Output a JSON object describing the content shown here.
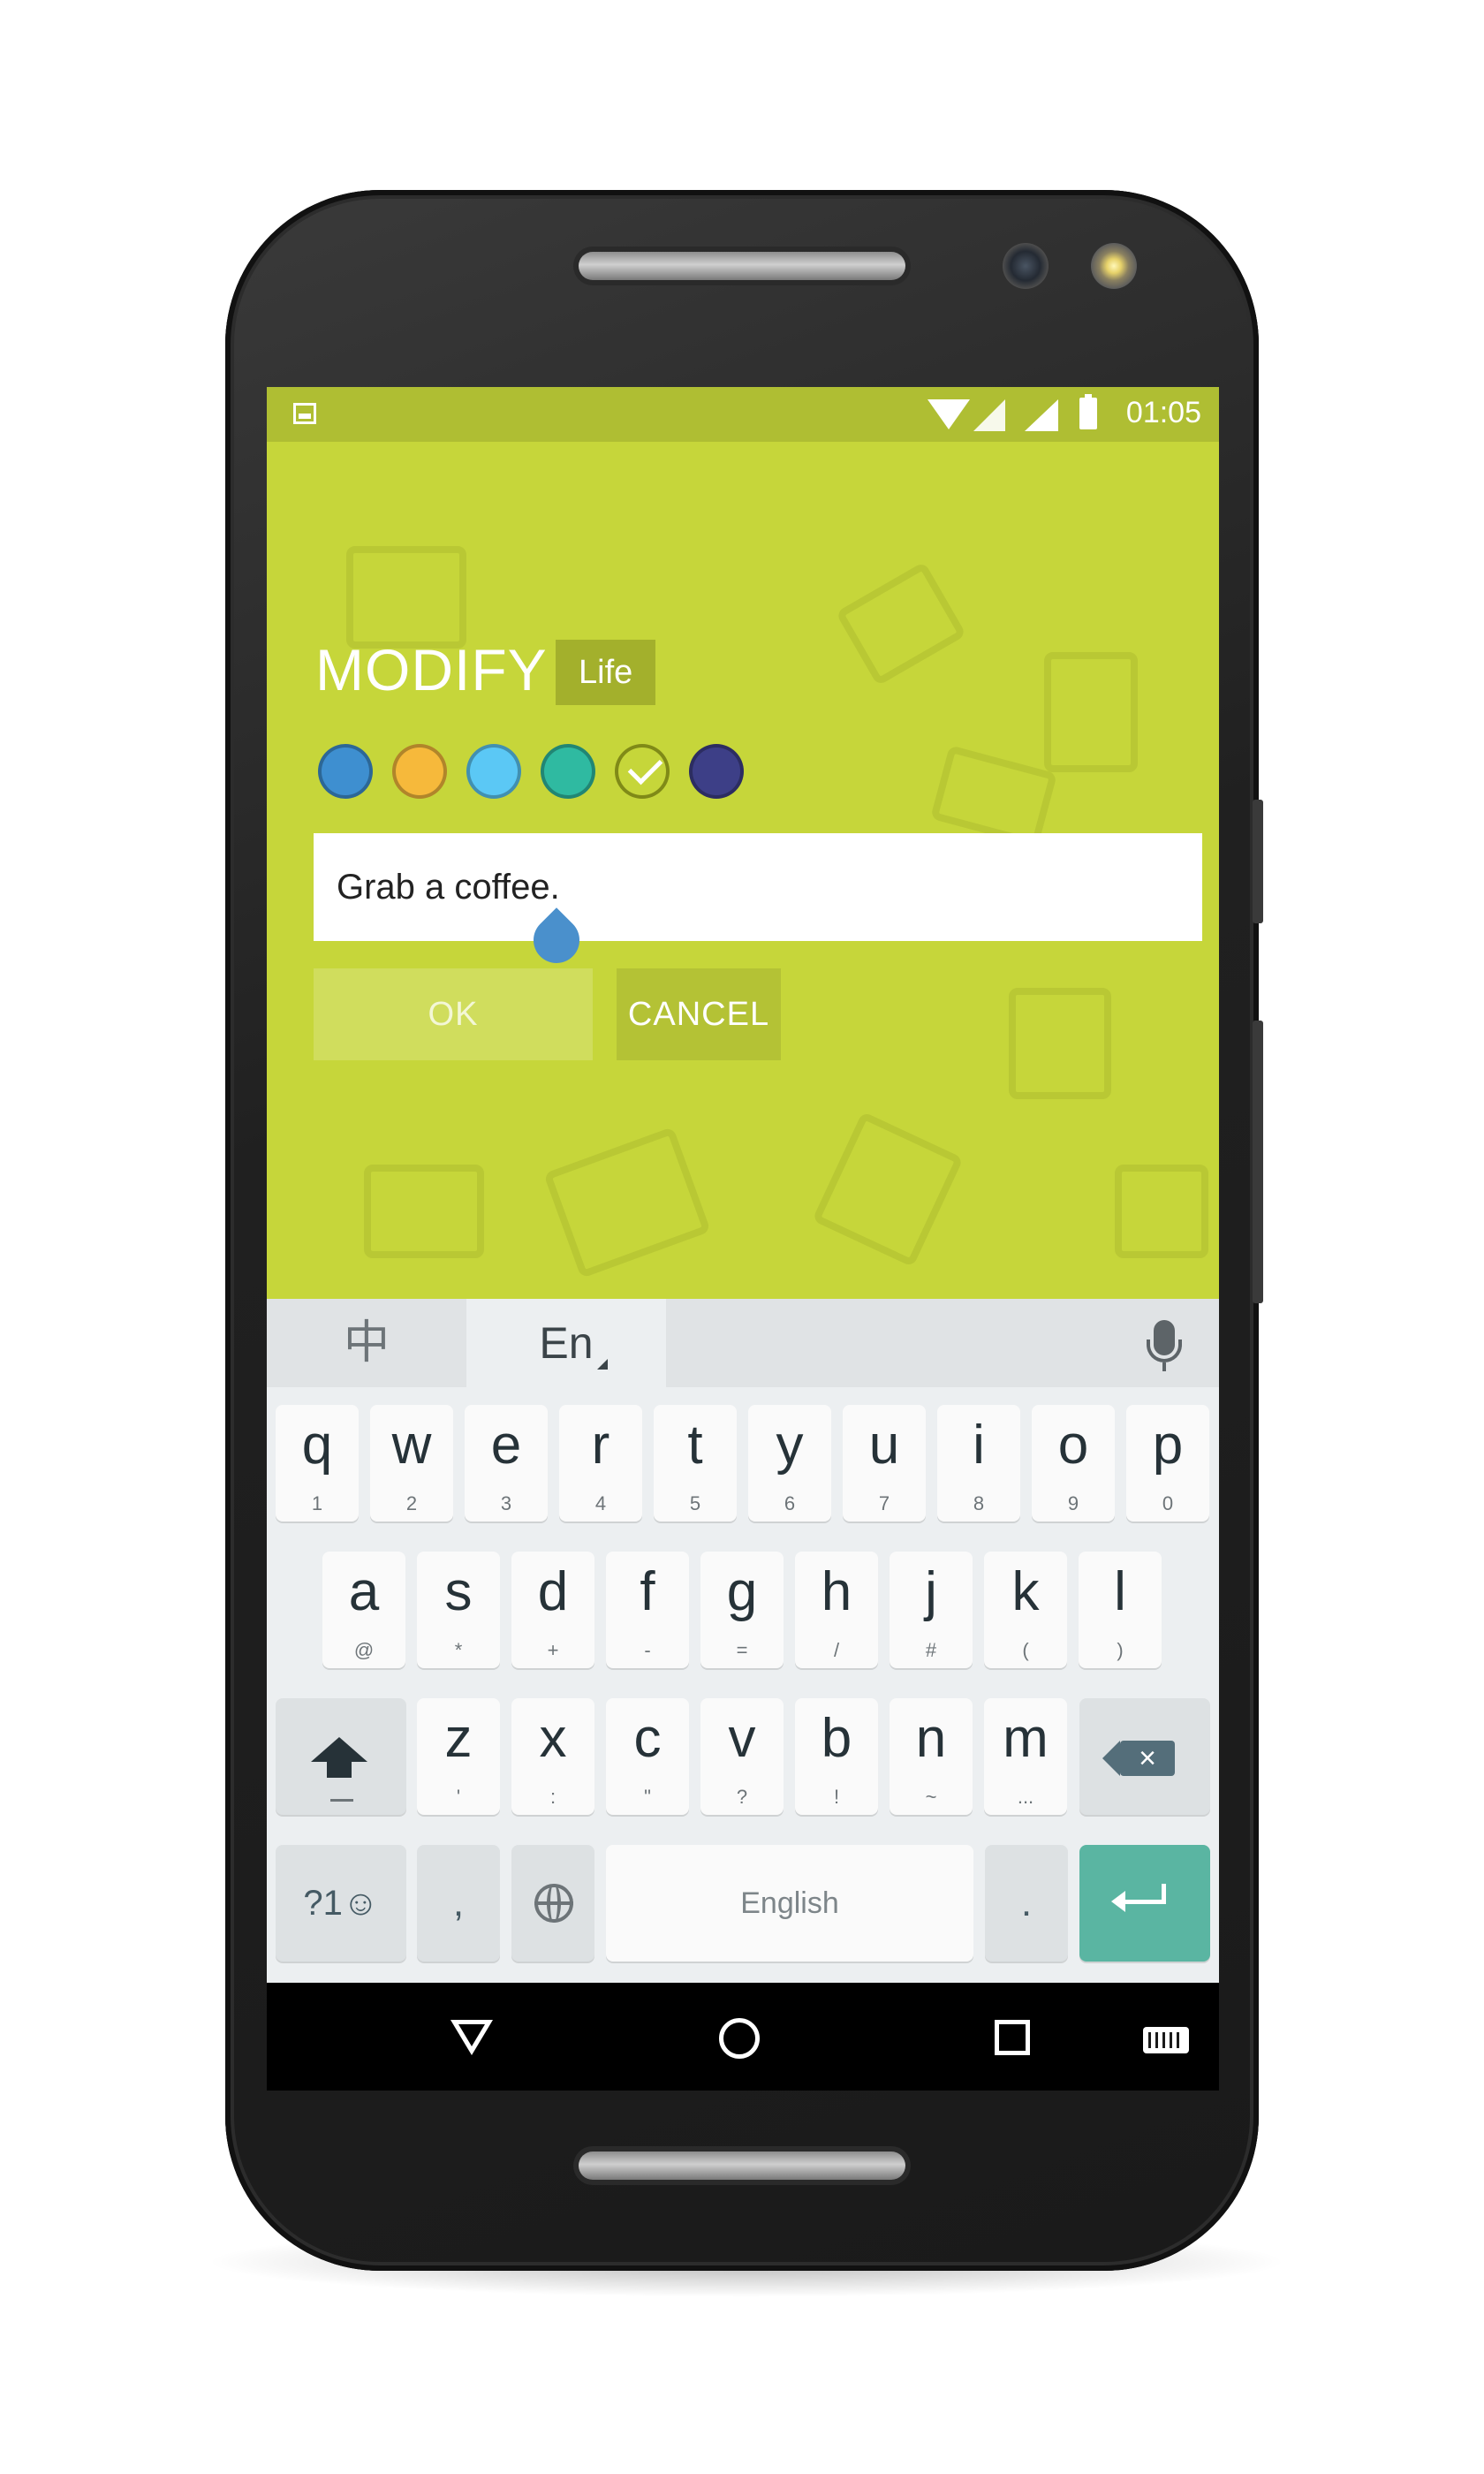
{
  "status_bar": {
    "time": "01:05"
  },
  "dialog": {
    "title": "MODIFY",
    "category": "Life",
    "colors": [
      "#3e8fd0",
      "#f6b93b",
      "#5bc8f5",
      "#2fbaa1",
      "#c6d63a",
      "#3d3f87"
    ],
    "selected_color_index": 4,
    "task_text": "Grab a coffee.",
    "ok_label": "OK",
    "cancel_label": "CANCEL"
  },
  "keyboard": {
    "lang_chinese": "中",
    "lang_english": "En",
    "row1": [
      {
        "k": "q",
        "s": "1"
      },
      {
        "k": "w",
        "s": "2"
      },
      {
        "k": "e",
        "s": "3"
      },
      {
        "k": "r",
        "s": "4"
      },
      {
        "k": "t",
        "s": "5"
      },
      {
        "k": "y",
        "s": "6"
      },
      {
        "k": "u",
        "s": "7"
      },
      {
        "k": "i",
        "s": "8"
      },
      {
        "k": "o",
        "s": "9"
      },
      {
        "k": "p",
        "s": "0"
      }
    ],
    "row2": [
      {
        "k": "a",
        "s": "@"
      },
      {
        "k": "s",
        "s": "*"
      },
      {
        "k": "d",
        "s": "+"
      },
      {
        "k": "f",
        "s": "-"
      },
      {
        "k": "g",
        "s": "="
      },
      {
        "k": "h",
        "s": "/"
      },
      {
        "k": "j",
        "s": "#"
      },
      {
        "k": "k",
        "s": "("
      },
      {
        "k": "l",
        "s": ")"
      }
    ],
    "row3": [
      {
        "k": "z",
        "s": "'"
      },
      {
        "k": "x",
        "s": ":"
      },
      {
        "k": "c",
        "s": "\""
      },
      {
        "k": "v",
        "s": "?"
      },
      {
        "k": "b",
        "s": "!"
      },
      {
        "k": "n",
        "s": "~"
      },
      {
        "k": "m",
        "s": "..."
      }
    ],
    "symbols_label": "?1☺",
    "comma_label": ",",
    "space_label": "English",
    "period_label": "."
  },
  "icons": {
    "status": [
      "image-icon",
      "wifi-icon",
      "signal-icon",
      "battery-icon"
    ],
    "nav": [
      "back-icon",
      "home-icon",
      "recents-icon",
      "keyboard-switch-icon"
    ]
  }
}
